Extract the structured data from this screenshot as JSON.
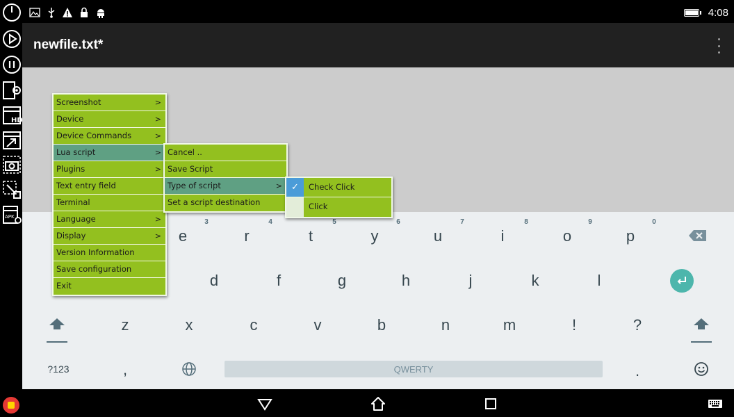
{
  "statusbar": {
    "time": "4:08",
    "icons": [
      "gallery-icon",
      "usb-icon",
      "warning-icon",
      "lock-icon",
      "android-icon"
    ]
  },
  "leftbar": {
    "tools": [
      "power-icon",
      "play-icon",
      "pause-icon",
      "settings-screen-icon",
      "hd-icon",
      "resize-icon",
      "camera-icon",
      "crop-icon",
      "apk-settings-icon"
    ],
    "apk_label": "APK",
    "hd_label": "HD",
    "record_button": "record-stop-icon"
  },
  "appbar": {
    "title": "newfile.txt*"
  },
  "menu_main": {
    "items": [
      {
        "label": "Screenshot",
        "submenu": true
      },
      {
        "label": "Device",
        "submenu": true
      },
      {
        "label": "Device Commands",
        "submenu": true
      },
      {
        "label": "Lua script",
        "submenu": true,
        "selected": true
      },
      {
        "label": "Plugins",
        "submenu": true
      },
      {
        "label": "Text entry field",
        "submenu": false
      },
      {
        "label": "Terminal",
        "submenu": false
      },
      {
        "label": "Language",
        "submenu": true
      },
      {
        "label": "Display",
        "submenu": true
      },
      {
        "label": "Version Information",
        "submenu": false
      },
      {
        "label": "Save configuration",
        "submenu": false
      },
      {
        "label": "Exit",
        "submenu": false
      }
    ],
    "arrow": ">"
  },
  "menu_lua": {
    "items": [
      {
        "label": "Cancel .."
      },
      {
        "label": "Save Script"
      },
      {
        "label": "Type of script",
        "selected": true
      },
      {
        "label": "Set a script destination"
      }
    ],
    "arrow": ">"
  },
  "menu_type": {
    "items": [
      {
        "label": "Check  Click",
        "checked": true
      },
      {
        "label": "Click",
        "checked": false
      }
    ],
    "check_mark": "✓"
  },
  "keyboard": {
    "hints": [
      "3",
      "4",
      "5",
      "6",
      "7",
      "8",
      "9",
      "0"
    ],
    "row1": [
      "e",
      "r",
      "t",
      "y",
      "u",
      "i",
      "o",
      "p"
    ],
    "row2": [
      "d",
      "f",
      "g",
      "h",
      "j",
      "k",
      "l"
    ],
    "row3": [
      "z",
      "x",
      "c",
      "v",
      "b",
      "n",
      "m",
      "!",
      "?"
    ],
    "symbols_label": "?123",
    "comma": ",",
    "period": ".",
    "space_label": "QWERTY"
  },
  "colors": {
    "menu_item": "#93c01f",
    "menu_selected": "#5fa083",
    "check_selected": "#4b9cd8",
    "enter_key": "#4db6ac",
    "app_bar": "#212121",
    "editor_bg": "#cccccc",
    "keyboard_bg": "#eceff1"
  }
}
